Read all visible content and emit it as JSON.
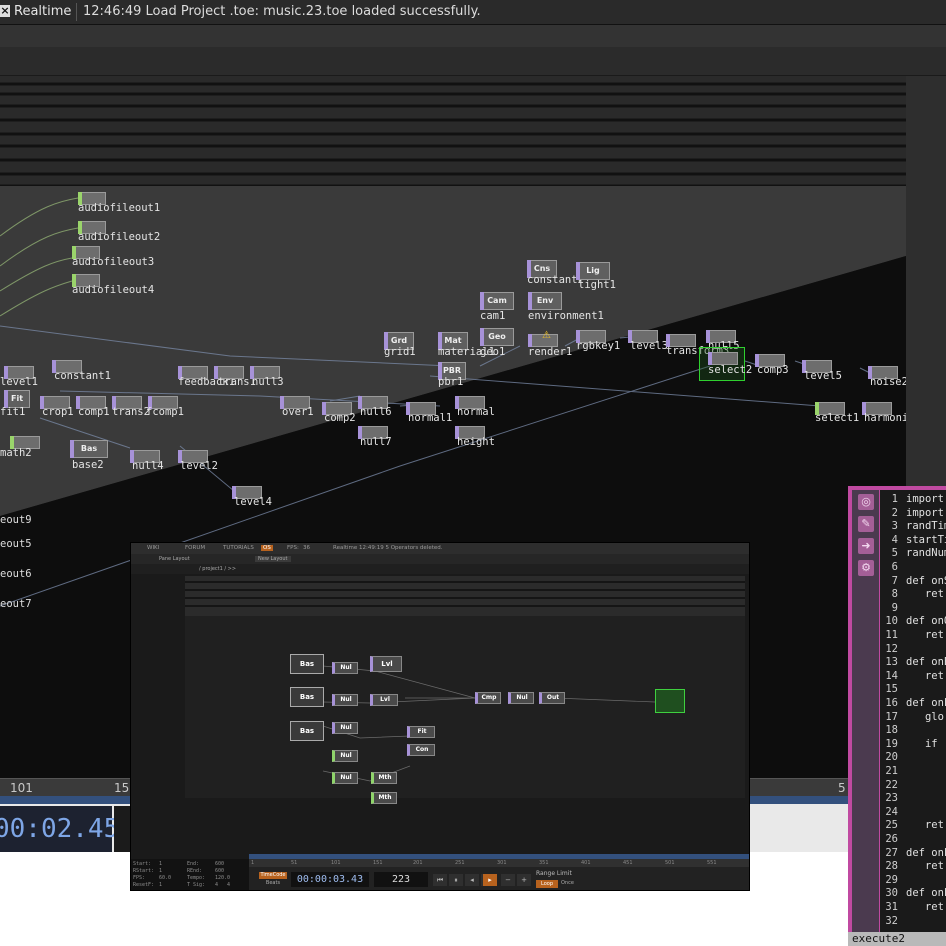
{
  "status": {
    "close_glyph": "×",
    "mode": "Realtime",
    "message": "12:46:49 Load Project .toe: music.23.toe loaded successfully."
  },
  "network": {
    "operators": [
      {
        "label": "audiofileout1"
      },
      {
        "label": "audiofileout2"
      },
      {
        "label": "audiofileout3"
      },
      {
        "label": "audiofileout4"
      },
      {
        "label": "constant2"
      },
      {
        "label": "light1"
      },
      {
        "label": "cam1"
      },
      {
        "label": "environment1"
      },
      {
        "label": "grid1"
      },
      {
        "label": "material1"
      },
      {
        "label": "geo1"
      },
      {
        "label": "render1"
      },
      {
        "label": "rgbkey1"
      },
      {
        "label": "level3"
      },
      {
        "label": "transform3"
      },
      {
        "label": "null5"
      },
      {
        "label": "select2"
      },
      {
        "label": "comp3"
      },
      {
        "label": "level5"
      },
      {
        "label": "noise2"
      },
      {
        "label": "pbr1"
      },
      {
        "label": "level1"
      },
      {
        "label": "constant1"
      },
      {
        "label": "feedback1"
      },
      {
        "label": "trans1"
      },
      {
        "label": "null3"
      },
      {
        "label": "fit1"
      },
      {
        "label": "crop1"
      },
      {
        "label": "comp1"
      },
      {
        "label": "trans2"
      },
      {
        "label": "fcomp1"
      },
      {
        "label": "over1"
      },
      {
        "label": "comp2"
      },
      {
        "label": "null6"
      },
      {
        "label": "normal1"
      },
      {
        "label": "normal"
      },
      {
        "label": "null7"
      },
      {
        "label": "height"
      },
      {
        "label": "math2"
      },
      {
        "label": "base2"
      },
      {
        "label": "null4"
      },
      {
        "label": "level2"
      },
      {
        "label": "level4"
      },
      {
        "label": "select1"
      },
      {
        "label": "harmonicGain"
      }
    ],
    "big_op_titles": {
      "cam": "Cam",
      "env": "Env",
      "geo": "Geo",
      "light": "Lig",
      "const": "Cns",
      "grid": "Grd",
      "mat": "Mat",
      "pbr": "PBR",
      "base": "Bas",
      "fit": "Fit"
    },
    "left_labels": [
      "eout9",
      "eout5",
      "eout6",
      "eout7"
    ],
    "warning_glyph": "⚠"
  },
  "timeline": {
    "ticks": [
      "101",
      "15",
      "5"
    ],
    "current_time": "00:02.45"
  },
  "inner": {
    "tabs": [
      "WIKI",
      "FORUM",
      "TUTORIALS",
      "OS",
      "FPS:",
      "36",
      "Realtime",
      "12:49:19 5 Operators deleted."
    ],
    "pane_layout": "Pane Layout",
    "new_layout": "New Layout",
    "path": "/ project1 / >>",
    "nodes": {
      "bas1": "Bas",
      "bas2": "Bas",
      "bas3": "Bas",
      "lvl1": "Lvl",
      "lvl2": "Lvl",
      "nul1": "Nul",
      "nul2": "Nul",
      "nul3": "Nul",
      "nul4": "Nul",
      "nul5": "Nul",
      "nul6": "Nul",
      "fit": "Fit",
      "con": "Con",
      "mth1": "Mth",
      "mth2": "Mth",
      "cmp": "Cmp",
      "out": "Out"
    },
    "stats": [
      "Start:",
      "1",
      "End:",
      "600",
      "RStart:",
      "1",
      "REnd:",
      "600",
      "FPS:",
      "60.0",
      "Tempo:",
      "120.0",
      "ResetF:",
      "1",
      "T Sig:",
      "4",
      "4"
    ],
    "ruler_ticks": [
      "1",
      "51",
      "101",
      "151",
      "201",
      "251",
      "301",
      "351",
      "401",
      "451",
      "501",
      "551"
    ],
    "timecode_label": "TimeCode",
    "beats_label": "Beats",
    "current_time": "00:00:03.43",
    "frame": "223",
    "range_limit": "Range Limit",
    "loop": "Loop",
    "once": "Once"
  },
  "editor": {
    "title": "execute2",
    "lines": [
      {
        "n": "1",
        "t": "import"
      },
      {
        "n": "2",
        "t": "import"
      },
      {
        "n": "3",
        "t": "randTim"
      },
      {
        "n": "4",
        "t": "startTi"
      },
      {
        "n": "5",
        "t": "randNum"
      },
      {
        "n": "6",
        "t": ""
      },
      {
        "n": "7",
        "t": "def onS"
      },
      {
        "n": "8",
        "t": "   ret"
      },
      {
        "n": "9",
        "t": ""
      },
      {
        "n": "10",
        "t": "def onO"
      },
      {
        "n": "11",
        "t": "   ret"
      },
      {
        "n": "12",
        "t": ""
      },
      {
        "n": "13",
        "t": "def onE"
      },
      {
        "n": "14",
        "t": "   ret"
      },
      {
        "n": "15",
        "t": ""
      },
      {
        "n": "16",
        "t": "def onF"
      },
      {
        "n": "17",
        "t": "   glo"
      },
      {
        "n": "18",
        "t": ""
      },
      {
        "n": "19",
        "t": "   if"
      },
      {
        "n": "20",
        "t": ""
      },
      {
        "n": "21",
        "t": ""
      },
      {
        "n": "22",
        "t": ""
      },
      {
        "n": "23",
        "t": ""
      },
      {
        "n": "24",
        "t": ""
      },
      {
        "n": "25",
        "t": "   ret"
      },
      {
        "n": "26",
        "t": ""
      },
      {
        "n": "27",
        "t": "def onF"
      },
      {
        "n": "28",
        "t": "   ret"
      },
      {
        "n": "29",
        "t": ""
      },
      {
        "n": "30",
        "t": "def onF"
      },
      {
        "n": "31",
        "t": "   ret"
      },
      {
        "n": "32",
        "t": ""
      }
    ]
  }
}
